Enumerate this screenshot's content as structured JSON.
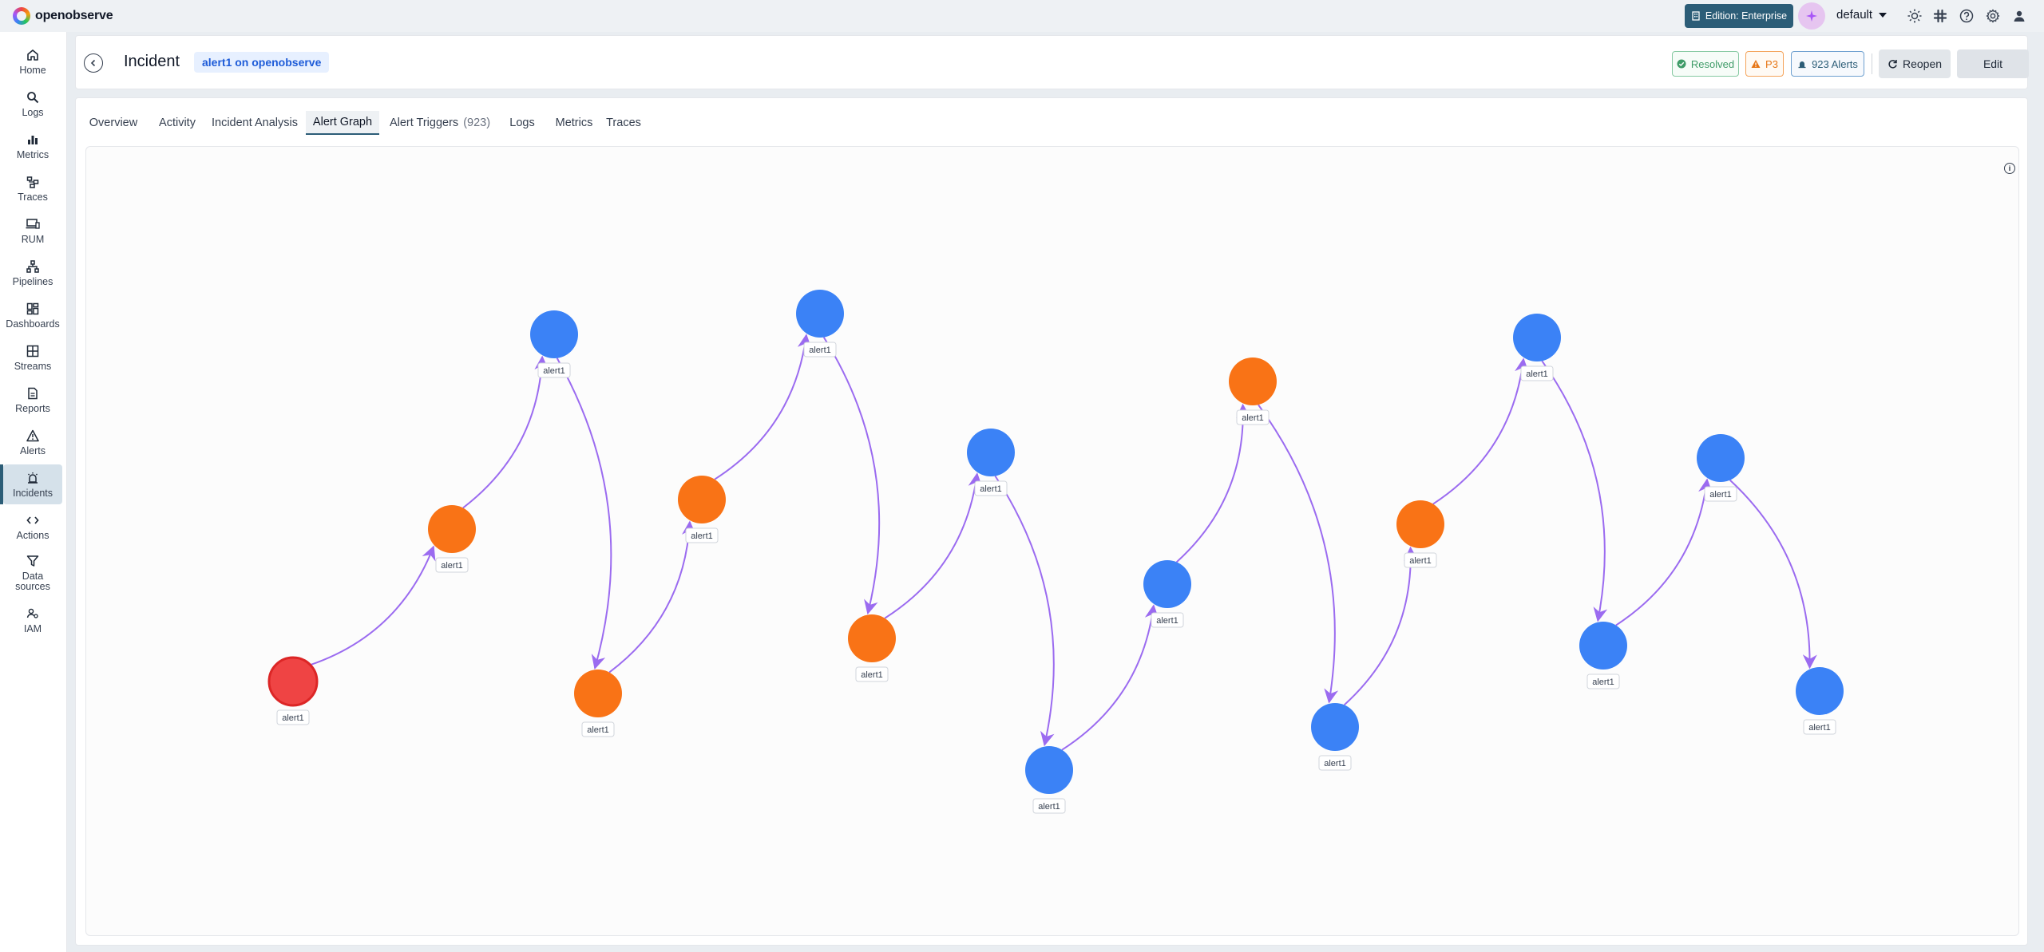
{
  "brand": {
    "name": "openobserve"
  },
  "topbar": {
    "edition_label": "Edition: Enterprise",
    "org_name": "default"
  },
  "sidebar": {
    "items": [
      {
        "label": "Home",
        "icon": "home-icon"
      },
      {
        "label": "Logs",
        "icon": "search-icon"
      },
      {
        "label": "Metrics",
        "icon": "bar-chart-icon"
      },
      {
        "label": "Traces",
        "icon": "traces-icon"
      },
      {
        "label": "RUM",
        "icon": "devices-icon"
      },
      {
        "label": "Pipelines",
        "icon": "pipeline-icon"
      },
      {
        "label": "Dashboards",
        "icon": "dashboard-icon"
      },
      {
        "label": "Streams",
        "icon": "grid-icon"
      },
      {
        "label": "Reports",
        "icon": "report-icon"
      },
      {
        "label": "Alerts",
        "icon": "warning-icon"
      },
      {
        "label": "Incidents",
        "icon": "alarm-icon"
      },
      {
        "label": "Actions",
        "icon": "code-icon"
      },
      {
        "label": "Data sources",
        "icon": "filter-icon"
      },
      {
        "label": "IAM",
        "icon": "users-icon"
      }
    ],
    "active": "Incidents"
  },
  "header": {
    "title": "Incident",
    "badge": "alert1 on openobserve",
    "status": "Resolved",
    "priority": "P3",
    "alerts_count": "923 Alerts",
    "reopen_label": "Reopen",
    "edit_label": "Edit"
  },
  "tabs": [
    {
      "label": "Overview"
    },
    {
      "label": "Activity"
    },
    {
      "label": "Incident Analysis"
    },
    {
      "label": "Alert Graph",
      "active": true
    },
    {
      "label": "Alert Triggers",
      "count": "(923)"
    },
    {
      "label": "Logs"
    },
    {
      "label": "Metrics"
    },
    {
      "label": "Traces"
    }
  ],
  "colors": {
    "root": "#ef4444",
    "orange": "#f97316",
    "blue": "#3b82f6",
    "edge": "#9b6bf0",
    "accent": "#2c5d77"
  },
  "graph": {
    "nodes": [
      {
        "label": "alert1",
        "color": "root"
      },
      {
        "label": "alert1",
        "color": "orange"
      },
      {
        "label": "alert1",
        "color": "blue"
      },
      {
        "label": "alert1",
        "color": "orange"
      },
      {
        "label": "alert1",
        "color": "orange"
      },
      {
        "label": "alert1",
        "color": "blue"
      },
      {
        "label": "alert1",
        "color": "orange"
      },
      {
        "label": "alert1",
        "color": "blue"
      },
      {
        "label": "alert1",
        "color": "blue"
      },
      {
        "label": "alert1",
        "color": "blue"
      },
      {
        "label": "alert1",
        "color": "orange"
      },
      {
        "label": "alert1",
        "color": "blue"
      },
      {
        "label": "alert1",
        "color": "orange"
      },
      {
        "label": "alert1",
        "color": "blue"
      },
      {
        "label": "alert1",
        "color": "blue"
      },
      {
        "label": "alert1",
        "color": "blue"
      },
      {
        "label": "alert1",
        "color": "blue"
      }
    ]
  }
}
